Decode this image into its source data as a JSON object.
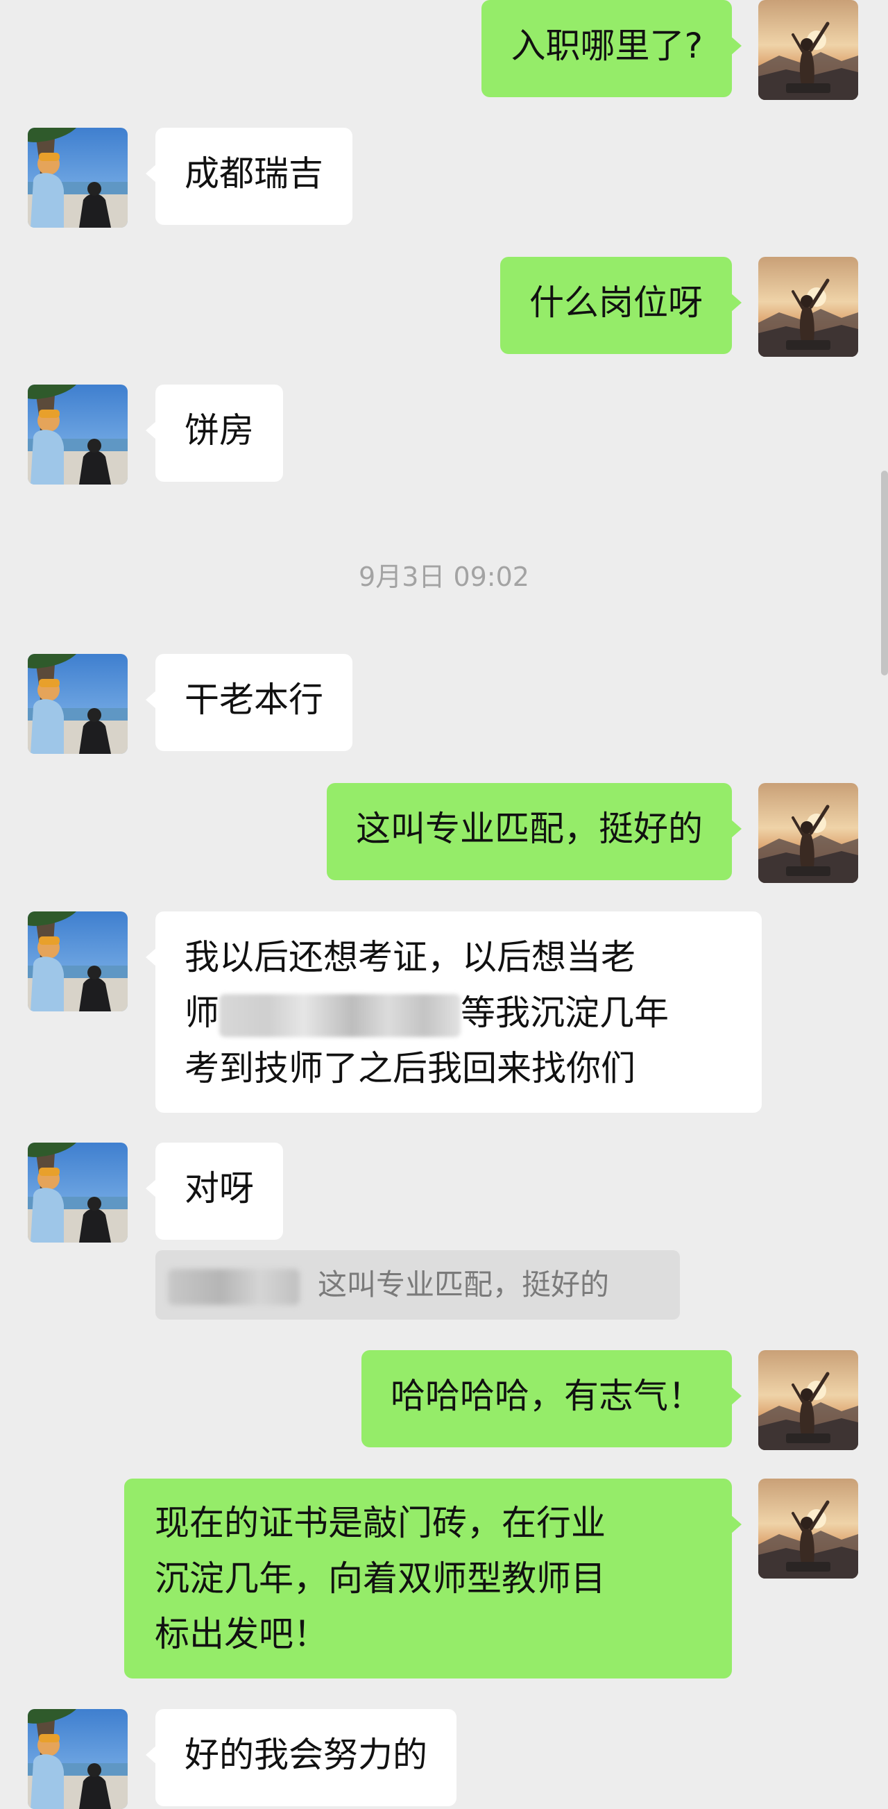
{
  "messages": [
    {
      "id": "m1",
      "side": "out",
      "text": "入职哪里了?"
    },
    {
      "id": "m2",
      "side": "in",
      "text": "成都瑞吉"
    },
    {
      "id": "m3",
      "side": "out",
      "text": "什么岗位呀"
    },
    {
      "id": "m4",
      "side": "in",
      "text": "饼房"
    },
    {
      "id": "m5",
      "side": "in",
      "text": "干老本行"
    },
    {
      "id": "m6",
      "side": "out",
      "text": "这叫专业匹配，挺好的"
    },
    {
      "id": "m7",
      "side": "in",
      "lines": [
        "我以后还想考证，以后想当老",
        "师",
        "等我沉淀几年",
        "考到技师了之后我回来找你们"
      ]
    },
    {
      "id": "m8",
      "side": "in",
      "text": "对呀"
    },
    {
      "id": "m9",
      "side": "out",
      "text": "哈哈哈哈，有志气！"
    },
    {
      "id": "m10",
      "side": "out",
      "lines": [
        "现在的证书是敲门砖，在行业",
        "沉淀几年，向着双师型教师目",
        "标出发吧！"
      ]
    },
    {
      "id": "m11",
      "side": "in",
      "text": "好的我会努力的"
    }
  ],
  "timestamp": "9月3日 09:02",
  "quote": {
    "text": "这叫专业匹配，挺好的"
  },
  "avatars": {
    "self": "avatar-sunset-woman",
    "contact": "avatar-beach-tree-man"
  }
}
